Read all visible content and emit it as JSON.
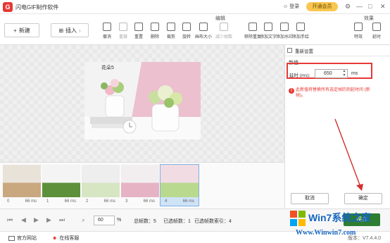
{
  "app": {
    "title": "闪电GIF制作软件",
    "logo_letter": "G",
    "login": "登录",
    "vip": "开通会员"
  },
  "window_controls": {
    "settings": "⚙",
    "minimize": "—",
    "maximize": "□",
    "close": "✕"
  },
  "toolbar": {
    "group_edit": "编辑",
    "group_effects": "效果",
    "new_label": "新建",
    "import_label": "插入",
    "tools": [
      {
        "label": "撤消",
        "enabled": true
      },
      {
        "label": "重做",
        "enabled": false
      },
      {
        "label": "重置",
        "enabled": true
      },
      {
        "label": "删除",
        "enabled": true
      },
      {
        "label": "裁剪",
        "enabled": true
      },
      {
        "label": "旋转",
        "enabled": true
      },
      {
        "label": "画布大小",
        "enabled": true
      },
      {
        "label": "减少帧数",
        "enabled": false
      },
      {
        "label": "移除重复",
        "enabled": true
      },
      {
        "label": "添加文字",
        "enabled": true
      },
      {
        "label": "添加水印",
        "enabled": true
      },
      {
        "label": "添加手绘",
        "enabled": true
      },
      {
        "label": "特效",
        "enabled": true
      },
      {
        "label": "延时",
        "enabled": true
      }
    ]
  },
  "preview": {
    "caption": "花朵5"
  },
  "panel": {
    "title": "重新设置",
    "section": "新值",
    "delay_label": "延时 (ms):",
    "delay_value": "650",
    "unit": "ms",
    "warning": "此新值将替换所有选定帧的到延时间 (新帧)。",
    "cancel": "取消",
    "ok": "确定"
  },
  "frames": [
    {
      "index": "0",
      "duration": "66 ms",
      "selected": false
    },
    {
      "index": "1",
      "duration": "66 ms",
      "selected": false
    },
    {
      "index": "2",
      "duration": "66 ms",
      "selected": false
    },
    {
      "index": "3",
      "duration": "66 ms",
      "selected": false
    },
    {
      "index": "4",
      "duration": "66 ms",
      "selected": true
    }
  ],
  "bottombar": {
    "zoom": "60",
    "zoom_unit": "%",
    "total_frames": "总帧数：5",
    "selected_frames": "已选帧数：1",
    "selected_index": "已选帧数索引：4",
    "save": "保存"
  },
  "statusbar": {
    "website": "官方网站",
    "support": "在线客服",
    "version": "版本：V7.4.4.0"
  },
  "watermark": {
    "text": "Win7系统之家",
    "url": "Www.Winwin7.com"
  },
  "colors": {
    "accent_red": "#e53935",
    "selection_blue": "#cfe3f7",
    "save_green": "#2e7d32",
    "vip_gold": "#f9c74f"
  }
}
